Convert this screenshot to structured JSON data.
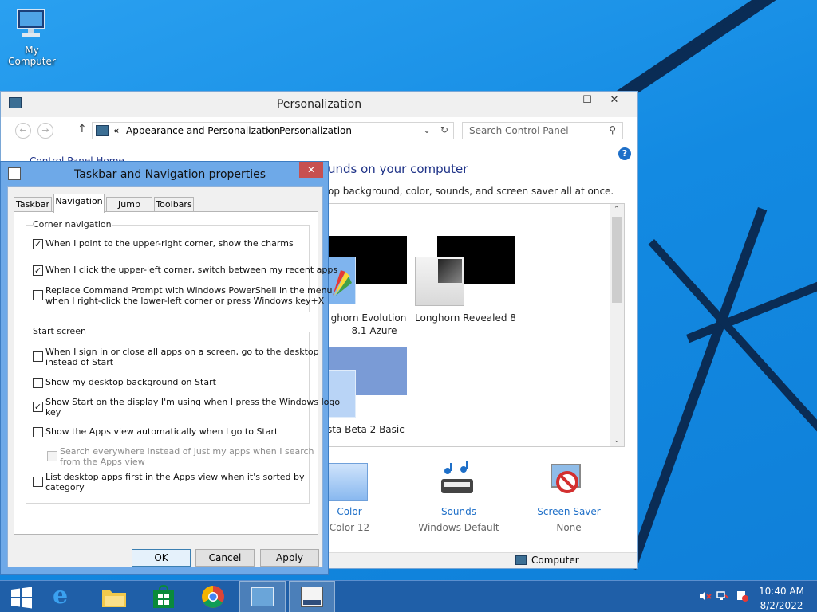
{
  "desktop": {
    "icon_label": "My Computer"
  },
  "control_panel": {
    "title": "Personalization",
    "address": {
      "prefix": "«",
      "crumb1": "Appearance and Personalization",
      "sep": "›",
      "crumb2": "Personalization"
    },
    "search_placeholder": "Search Control Panel",
    "left_link": "Control Panel Home",
    "heading": "unds on your computer",
    "subtext": "op background, color, sounds, and screen saver all at once.",
    "themes": [
      {
        "label_line1": "ghorn Evolution",
        "label_line2": "8.1 Azure"
      },
      {
        "label_line1": "Longhorn Revealed 8",
        "label_line2": ""
      },
      {
        "label_line1": "sta Beta 2 Basic",
        "label_line2": ""
      }
    ],
    "bottom_items": [
      {
        "name": "Color",
        "value": "Color 12"
      },
      {
        "name": "Sounds",
        "value": "Windows Default"
      },
      {
        "name": "Screen Saver",
        "value": "None"
      }
    ],
    "status": "Computer"
  },
  "dialog": {
    "title": "Taskbar and Navigation properties",
    "tabs": [
      "Taskbar",
      "Navigation",
      "Jump Lists",
      "Toolbars"
    ],
    "active_tab": "Navigation",
    "corner_group": {
      "label": "Corner navigation",
      "options": [
        {
          "line1": "When I point to the upper-right corner, show the charms",
          "line2": "",
          "checked": true
        },
        {
          "line1": "When I click the upper-left corner, switch between my recent apps",
          "line2": "",
          "checked": true
        },
        {
          "line1": "Replace Command Prompt with Windows PowerShell in the menu",
          "line2": "when I right-click the lower-left corner or press Windows key+X",
          "checked": false
        }
      ]
    },
    "start_group": {
      "label": "Start screen",
      "options": [
        {
          "line1": "When I sign in or close all apps on a screen, go to the desktop",
          "line2": "instead of Start",
          "checked": false
        },
        {
          "line1": "Show my desktop background on Start",
          "line2": "",
          "checked": false
        },
        {
          "line1": "Show Start on the display I'm using when I press the Windows logo",
          "line2": "key",
          "checked": true
        },
        {
          "line1": "Show the Apps view automatically when I go to Start",
          "line2": "",
          "checked": false
        },
        {
          "line1": "Search everywhere instead of just my apps when I search",
          "line2": "from the Apps view",
          "checked": false,
          "disabled": true
        },
        {
          "line1": "List desktop apps first in the Apps view when it's sorted by",
          "line2": "category",
          "checked": false
        }
      ]
    },
    "buttons": {
      "ok": "OK",
      "cancel": "Cancel",
      "apply": "Apply"
    }
  },
  "taskbar": {
    "clock_time": "10:40 AM",
    "clock_date": "8/2/2022"
  }
}
